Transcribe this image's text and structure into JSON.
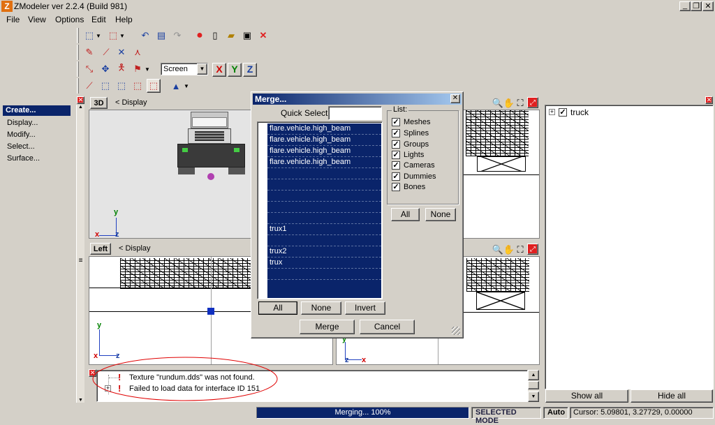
{
  "app": {
    "title": "ZModeler ver 2.2.4 (Build 981)"
  },
  "menu": [
    "File",
    "View",
    "Options",
    "Edit",
    "Help"
  ],
  "toolbar": {
    "coord_select": "Screen",
    "axis_x": "X",
    "axis_y": "Y",
    "axis_z": "Z"
  },
  "left_panel": {
    "items": [
      "Create...",
      "Display...",
      "Modify...",
      "Select...",
      "Surface..."
    ]
  },
  "viewports": {
    "top_left": {
      "name": "3D",
      "display": "< Display"
    },
    "bottom_left": {
      "name": "Left",
      "display": "< Display"
    }
  },
  "axis": {
    "x": "x",
    "y": "y",
    "z": "z"
  },
  "merge_dialog": {
    "title": "Merge...",
    "quick_select_label": "Quick Select:",
    "quick_select_value": "",
    "items": [
      "flare.vehicle.high_beam",
      "flare.vehicle.high_beam",
      "flare.vehicle.high_beam",
      "flare.vehicle.high_beam",
      "",
      "",
      "",
      "",
      "",
      "trux1",
      "",
      "trux2",
      "trux",
      ""
    ],
    "list_group_label": "List:",
    "filters": [
      "Meshes",
      "Splines",
      "Groups",
      "Lights",
      "Cameras",
      "Dummies",
      "Bones"
    ],
    "filters_all": "All",
    "filters_none": "None",
    "btn_all": "All",
    "btn_none": "None",
    "btn_invert": "Invert",
    "btn_merge": "Merge",
    "btn_cancel": "Cancel"
  },
  "tree": {
    "root": "truck"
  },
  "right_buttons": {
    "show_all": "Show all",
    "hide_all": "Hide all"
  },
  "log": [
    {
      "text": "Texture \"rundum.dds\" was not found.",
      "expandable": false
    },
    {
      "text": "Failed to load data for interface ID 151",
      "expandable": true
    }
  ],
  "status": {
    "progress_text": "Merging... 100%",
    "progress": 1.0,
    "mode": "SELECTED MODE",
    "auto": "Auto",
    "cursor": "Cursor: 5.09801, 3.27729, 0.00000"
  },
  "colors": {
    "selection": "#0a246a",
    "titlebar": "#d4d0c8",
    "face": "#d4d0c8"
  }
}
